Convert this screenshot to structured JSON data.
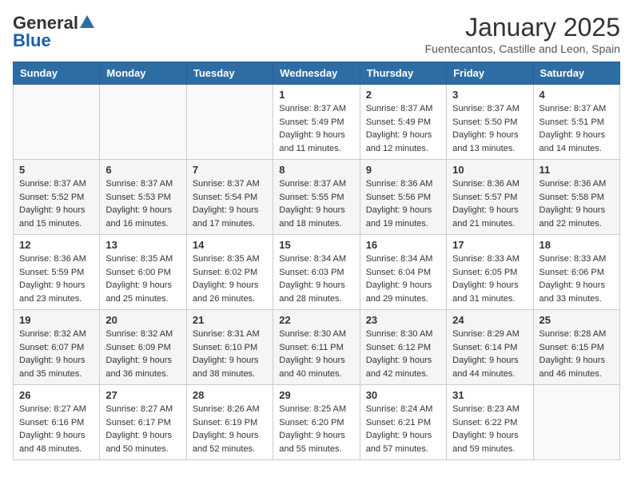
{
  "header": {
    "logo_general": "General",
    "logo_blue": "Blue",
    "month": "January 2025",
    "location": "Fuentecantos, Castille and Leon, Spain"
  },
  "days_of_week": [
    "Sunday",
    "Monday",
    "Tuesday",
    "Wednesday",
    "Thursday",
    "Friday",
    "Saturday"
  ],
  "weeks": [
    [
      {
        "day": "",
        "info": ""
      },
      {
        "day": "",
        "info": ""
      },
      {
        "day": "",
        "info": ""
      },
      {
        "day": "1",
        "info": "Sunrise: 8:37 AM\nSunset: 5:49 PM\nDaylight: 9 hours\nand 11 minutes."
      },
      {
        "day": "2",
        "info": "Sunrise: 8:37 AM\nSunset: 5:49 PM\nDaylight: 9 hours\nand 12 minutes."
      },
      {
        "day": "3",
        "info": "Sunrise: 8:37 AM\nSunset: 5:50 PM\nDaylight: 9 hours\nand 13 minutes."
      },
      {
        "day": "4",
        "info": "Sunrise: 8:37 AM\nSunset: 5:51 PM\nDaylight: 9 hours\nand 14 minutes."
      }
    ],
    [
      {
        "day": "5",
        "info": "Sunrise: 8:37 AM\nSunset: 5:52 PM\nDaylight: 9 hours\nand 15 minutes."
      },
      {
        "day": "6",
        "info": "Sunrise: 8:37 AM\nSunset: 5:53 PM\nDaylight: 9 hours\nand 16 minutes."
      },
      {
        "day": "7",
        "info": "Sunrise: 8:37 AM\nSunset: 5:54 PM\nDaylight: 9 hours\nand 17 minutes."
      },
      {
        "day": "8",
        "info": "Sunrise: 8:37 AM\nSunset: 5:55 PM\nDaylight: 9 hours\nand 18 minutes."
      },
      {
        "day": "9",
        "info": "Sunrise: 8:36 AM\nSunset: 5:56 PM\nDaylight: 9 hours\nand 19 minutes."
      },
      {
        "day": "10",
        "info": "Sunrise: 8:36 AM\nSunset: 5:57 PM\nDaylight: 9 hours\nand 21 minutes."
      },
      {
        "day": "11",
        "info": "Sunrise: 8:36 AM\nSunset: 5:58 PM\nDaylight: 9 hours\nand 22 minutes."
      }
    ],
    [
      {
        "day": "12",
        "info": "Sunrise: 8:36 AM\nSunset: 5:59 PM\nDaylight: 9 hours\nand 23 minutes."
      },
      {
        "day": "13",
        "info": "Sunrise: 8:35 AM\nSunset: 6:00 PM\nDaylight: 9 hours\nand 25 minutes."
      },
      {
        "day": "14",
        "info": "Sunrise: 8:35 AM\nSunset: 6:02 PM\nDaylight: 9 hours\nand 26 minutes."
      },
      {
        "day": "15",
        "info": "Sunrise: 8:34 AM\nSunset: 6:03 PM\nDaylight: 9 hours\nand 28 minutes."
      },
      {
        "day": "16",
        "info": "Sunrise: 8:34 AM\nSunset: 6:04 PM\nDaylight: 9 hours\nand 29 minutes."
      },
      {
        "day": "17",
        "info": "Sunrise: 8:33 AM\nSunset: 6:05 PM\nDaylight: 9 hours\nand 31 minutes."
      },
      {
        "day": "18",
        "info": "Sunrise: 8:33 AM\nSunset: 6:06 PM\nDaylight: 9 hours\nand 33 minutes."
      }
    ],
    [
      {
        "day": "19",
        "info": "Sunrise: 8:32 AM\nSunset: 6:07 PM\nDaylight: 9 hours\nand 35 minutes."
      },
      {
        "day": "20",
        "info": "Sunrise: 8:32 AM\nSunset: 6:09 PM\nDaylight: 9 hours\nand 36 minutes."
      },
      {
        "day": "21",
        "info": "Sunrise: 8:31 AM\nSunset: 6:10 PM\nDaylight: 9 hours\nand 38 minutes."
      },
      {
        "day": "22",
        "info": "Sunrise: 8:30 AM\nSunset: 6:11 PM\nDaylight: 9 hours\nand 40 minutes."
      },
      {
        "day": "23",
        "info": "Sunrise: 8:30 AM\nSunset: 6:12 PM\nDaylight: 9 hours\nand 42 minutes."
      },
      {
        "day": "24",
        "info": "Sunrise: 8:29 AM\nSunset: 6:14 PM\nDaylight: 9 hours\nand 44 minutes."
      },
      {
        "day": "25",
        "info": "Sunrise: 8:28 AM\nSunset: 6:15 PM\nDaylight: 9 hours\nand 46 minutes."
      }
    ],
    [
      {
        "day": "26",
        "info": "Sunrise: 8:27 AM\nSunset: 6:16 PM\nDaylight: 9 hours\nand 48 minutes."
      },
      {
        "day": "27",
        "info": "Sunrise: 8:27 AM\nSunset: 6:17 PM\nDaylight: 9 hours\nand 50 minutes."
      },
      {
        "day": "28",
        "info": "Sunrise: 8:26 AM\nSunset: 6:19 PM\nDaylight: 9 hours\nand 52 minutes."
      },
      {
        "day": "29",
        "info": "Sunrise: 8:25 AM\nSunset: 6:20 PM\nDaylight: 9 hours\nand 55 minutes."
      },
      {
        "day": "30",
        "info": "Sunrise: 8:24 AM\nSunset: 6:21 PM\nDaylight: 9 hours\nand 57 minutes."
      },
      {
        "day": "31",
        "info": "Sunrise: 8:23 AM\nSunset: 6:22 PM\nDaylight: 9 hours\nand 59 minutes."
      },
      {
        "day": "",
        "info": ""
      }
    ]
  ]
}
